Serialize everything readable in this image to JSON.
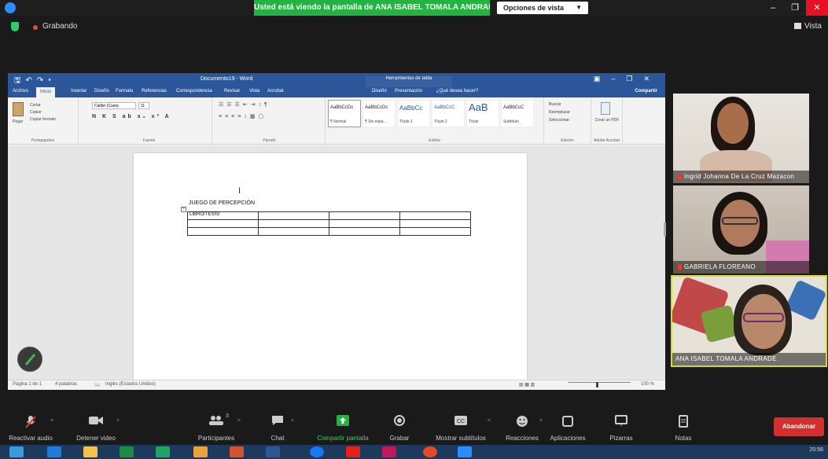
{
  "top_bar": {
    "share_banner": "Usted está viendo la pantalla de ANA ISABEL TOMALA ANDRADE",
    "view_options": "Opciones de vista",
    "recording_label": "Grabando",
    "view_label": "Vista"
  },
  "word": {
    "doc_title": "Documento19 - Word",
    "table_tools": "Herramientas de tabla",
    "tabs": [
      "Archivo",
      "Inicio",
      "Insertar",
      "Diseño",
      "Formato",
      "Referencias",
      "Correspondencia",
      "Revisar",
      "Vista",
      "Acrobat",
      "Diseño",
      "Presentación",
      "¿Qué desea hacer?"
    ],
    "share": "Compartir",
    "ribbon": {
      "clipboard": {
        "paste": "Pegar",
        "cut": "Cortar",
        "copy": "Copiar",
        "format_painter": "Copiar formato",
        "group": "Portapapeles"
      },
      "font": {
        "name": "Calibri (Cuerp",
        "size": "11",
        "group": "Fuente"
      },
      "paragraph_group": "Párrafo",
      "styles": [
        {
          "preview": "AaBbCcDc",
          "name": "¶ Normal"
        },
        {
          "preview": "AaBbCcDc",
          "name": "¶ Sin espa..."
        },
        {
          "preview": "AaBbCc",
          "name": "Título 1"
        },
        {
          "preview": "AaBbCcC",
          "name": "Título 2"
        },
        {
          "preview": "AaB",
          "name": "Título"
        },
        {
          "preview": "AaBbCcC",
          "name": "Subtítulo"
        }
      ],
      "styles_group": "Estilos",
      "editing": {
        "find": "Buscar",
        "replace": "Reemplazar",
        "select": "Seleccionar",
        "group": "Edición"
      },
      "acrobat": {
        "create_pdf": "Crear un PDF",
        "group": "Adobe Acrobat"
      }
    },
    "document": {
      "heading": "JUEGO DE PERCEPCIÓN",
      "table": [
        [
          "LIBRO/TESIS/",
          "",
          "",
          ""
        ],
        [
          "",
          "",
          "",
          ""
        ],
        [
          "",
          "",
          "",
          ""
        ]
      ]
    },
    "status": {
      "page": "Página 1 de 1",
      "words": "4 palabras",
      "language": "Inglés (Estados Unidos)",
      "zoom": "100 %"
    }
  },
  "participants": [
    {
      "name": "Ingrid Johanna De La Cruz Mazacon",
      "muted": true
    },
    {
      "name": "GABRIELA FLOREANO",
      "muted": true
    },
    {
      "name": "ANA ISABEL TOMALA ANDRADE",
      "muted": false,
      "active_speaker": true
    }
  ],
  "toolbar": {
    "unmute": "Reactivar audio",
    "stop_video": "Detener video",
    "participants": "Participantes",
    "participant_count": "3",
    "chat": "Chat",
    "share_screen": "Compartir pantalla",
    "record": "Grabar",
    "captions": "Mostrar subtítulos",
    "reactions": "Reacciones",
    "apps": "Aplicaciones",
    "whiteboards": "Pizarras",
    "notes": "Notas",
    "leave": "Abandonar"
  },
  "taskbar": {
    "time": "20:56"
  },
  "colors": {
    "share_green": "#24b340",
    "word_blue": "#2b579a",
    "leave_red": "#d32f2f",
    "active_speaker": "#d9d630"
  }
}
